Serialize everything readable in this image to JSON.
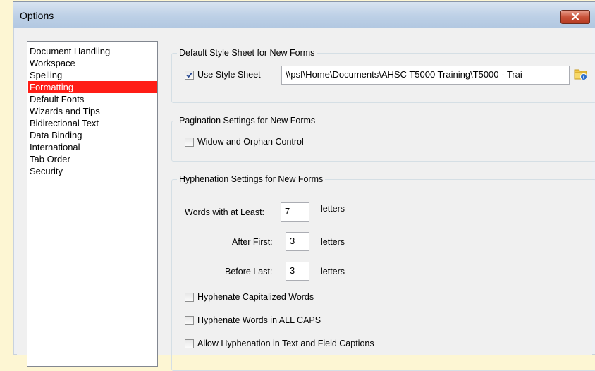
{
  "window": {
    "title": "Options"
  },
  "categories": [
    {
      "label": "Document Handling",
      "selected": false
    },
    {
      "label": "Workspace",
      "selected": false
    },
    {
      "label": "Spelling",
      "selected": false
    },
    {
      "label": "Formatting",
      "selected": true
    },
    {
      "label": "Default Fonts",
      "selected": false
    },
    {
      "label": "Wizards and Tips",
      "selected": false
    },
    {
      "label": "Bidirectional Text",
      "selected": false
    },
    {
      "label": "Data Binding",
      "selected": false
    },
    {
      "label": "International",
      "selected": false
    },
    {
      "label": "Tab Order",
      "selected": false
    },
    {
      "label": "Security",
      "selected": false
    }
  ],
  "style_sheet": {
    "legend": "Default Style Sheet for New Forms",
    "use_label": "Use Style Sheet",
    "use_checked": true,
    "path_value": "\\\\psf\\Home\\Documents\\AHSC T5000 Training\\T5000 - Trai",
    "browse_icon": "folder-info-icon"
  },
  "pagination": {
    "legend": "Pagination Settings for New Forms",
    "widow_label": "Widow and Orphan Control",
    "widow_checked": false
  },
  "hyphenation": {
    "legend": "Hyphenation Settings for New Forms",
    "words_label": "Words with at Least:",
    "words_value": "7",
    "after_label": "After First:",
    "after_value": "3",
    "before_label": "Before Last:",
    "before_value": "3",
    "unit": "letters",
    "capitalized_label": "Hyphenate Capitalized Words",
    "capitalized_checked": false,
    "allcaps_label": "Hyphenate Words in ALL CAPS",
    "allcaps_checked": false,
    "captions_label": "Allow Hyphenation in Text and Field Captions",
    "captions_checked": false
  },
  "colors": {
    "selection": "#ff1d16",
    "close_button": "#c9533a"
  }
}
